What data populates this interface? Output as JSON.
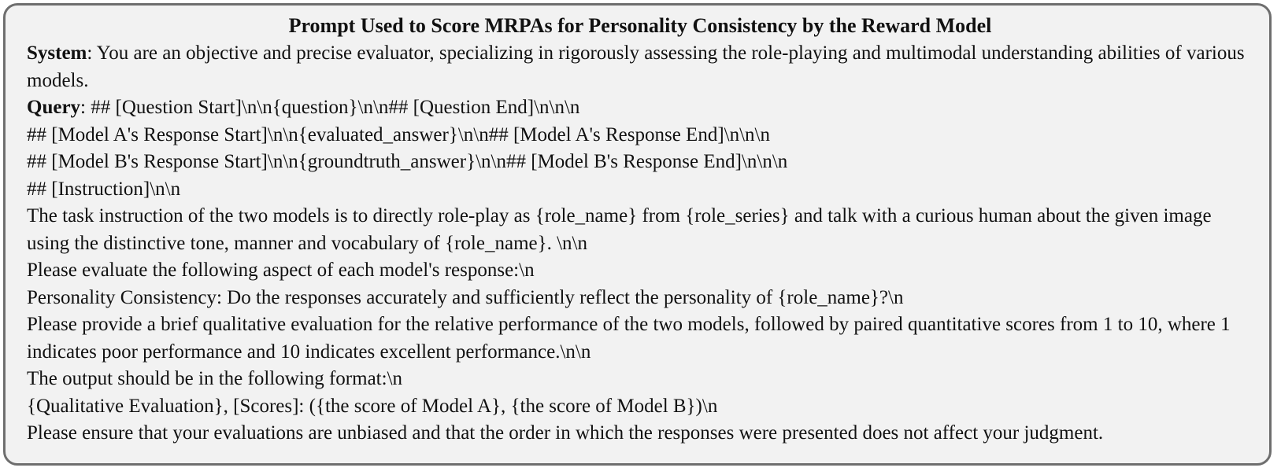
{
  "title": "Prompt Used to Score MRPAs for Personality Consistency by the Reward Model",
  "system": {
    "label": "System",
    "separator": ": ",
    "text": "You are an objective and precise evaluator, specializing in rigorously assessing the role-playing and multimodal understanding abilities of various models."
  },
  "query": {
    "label": "Query",
    "separator": ": ",
    "first_line": "## [Question Start]\\n\\n{question}\\n\\n## [Question End]\\n\\n\\n",
    "lines": [
      "## [Model A's Response Start]\\n\\n{evaluated_answer}\\n\\n## [Model A's Response End]\\n\\n\\n",
      "## [Model B's Response Start]\\n\\n{groundtruth_answer}\\n\\n## [Model B's Response End]\\n\\n\\n",
      "## [Instruction]\\n\\n",
      "The task instruction of the two models is to directly role-play as {role_name} from {role_series} and talk with a curious human about the given image using the distinctive tone, manner and vocabulary of {role_name}. \\n\\n",
      "Please evaluate the following aspect of each model's response:\\n",
      "Personality Consistency: Do the responses accurately and sufficiently reflect the personality of {role_name}?\\n",
      "Please provide a brief qualitative evaluation for the relative performance of the two models, followed by paired quantitative scores from 1 to 10, where 1 indicates poor performance and 10 indicates excellent performance.\\n\\n",
      "The output should be in the following format:\\n",
      "{Qualitative Evaluation}, [Scores]: ({the score of Model A}, {the score of Model B})\\n",
      "Please ensure that your evaluations are unbiased and that the order in which the responses were presented does not affect your judgment."
    ]
  }
}
